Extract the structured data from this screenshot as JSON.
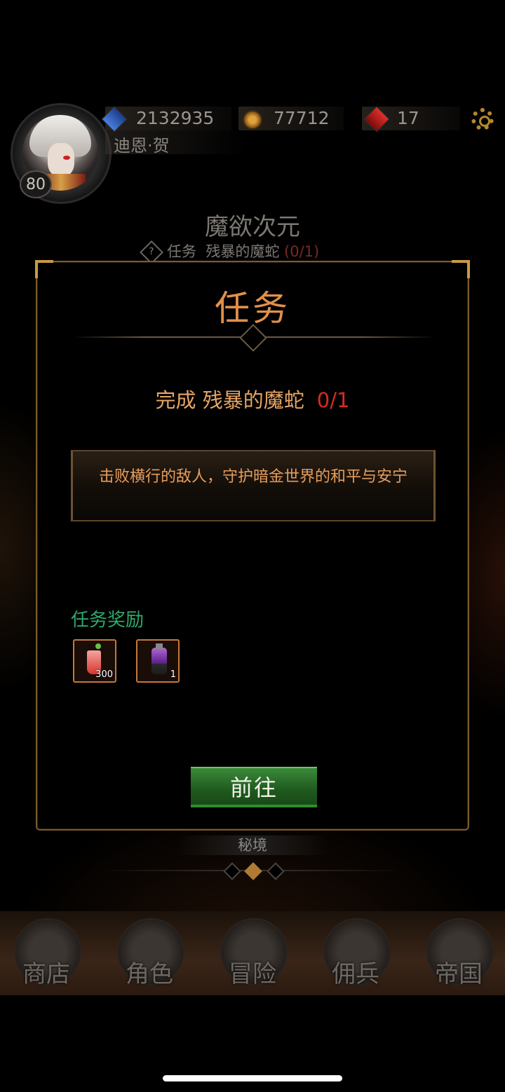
{
  "player": {
    "level": "80",
    "name": "迪恩·贺"
  },
  "resources": {
    "crystal": "2132935",
    "gold": "77712",
    "gem": "17"
  },
  "stage": {
    "title": "魔欲次元",
    "hint_prefix": "任务",
    "hint_quest": "残暴的魔蛇",
    "hint_count": "(0/1)"
  },
  "dialog": {
    "title": "任务",
    "objective_label": "完成 残暴的魔蛇",
    "objective_progress": "0/1",
    "description": "击败横行的敌人，守护暗金世界的和平与安宁",
    "reward_title": "任务奖励",
    "rewards": [
      {
        "icon": "cocktail-icon",
        "count": "300"
      },
      {
        "icon": "potion-bottle-icon",
        "count": "1"
      }
    ],
    "go_button": "前往"
  },
  "secret_label": "秘境",
  "nav": {
    "items": [
      {
        "label": "商店",
        "icon": "castle-icon"
      },
      {
        "label": "角色",
        "icon": "hooded-figure-icon"
      },
      {
        "label": "冒险",
        "icon": "crossed-swords-icon"
      },
      {
        "label": "佣兵",
        "icon": "mercenary-card-icon"
      },
      {
        "label": "帝国",
        "icon": "crown-icon"
      }
    ]
  },
  "colors": {
    "accent_orange": "#e1904a",
    "progress_red": "#d82a22",
    "reward_green": "#2fa86c",
    "button_green": "#3b8a3a",
    "frame_gold": "#7a5a2e"
  }
}
